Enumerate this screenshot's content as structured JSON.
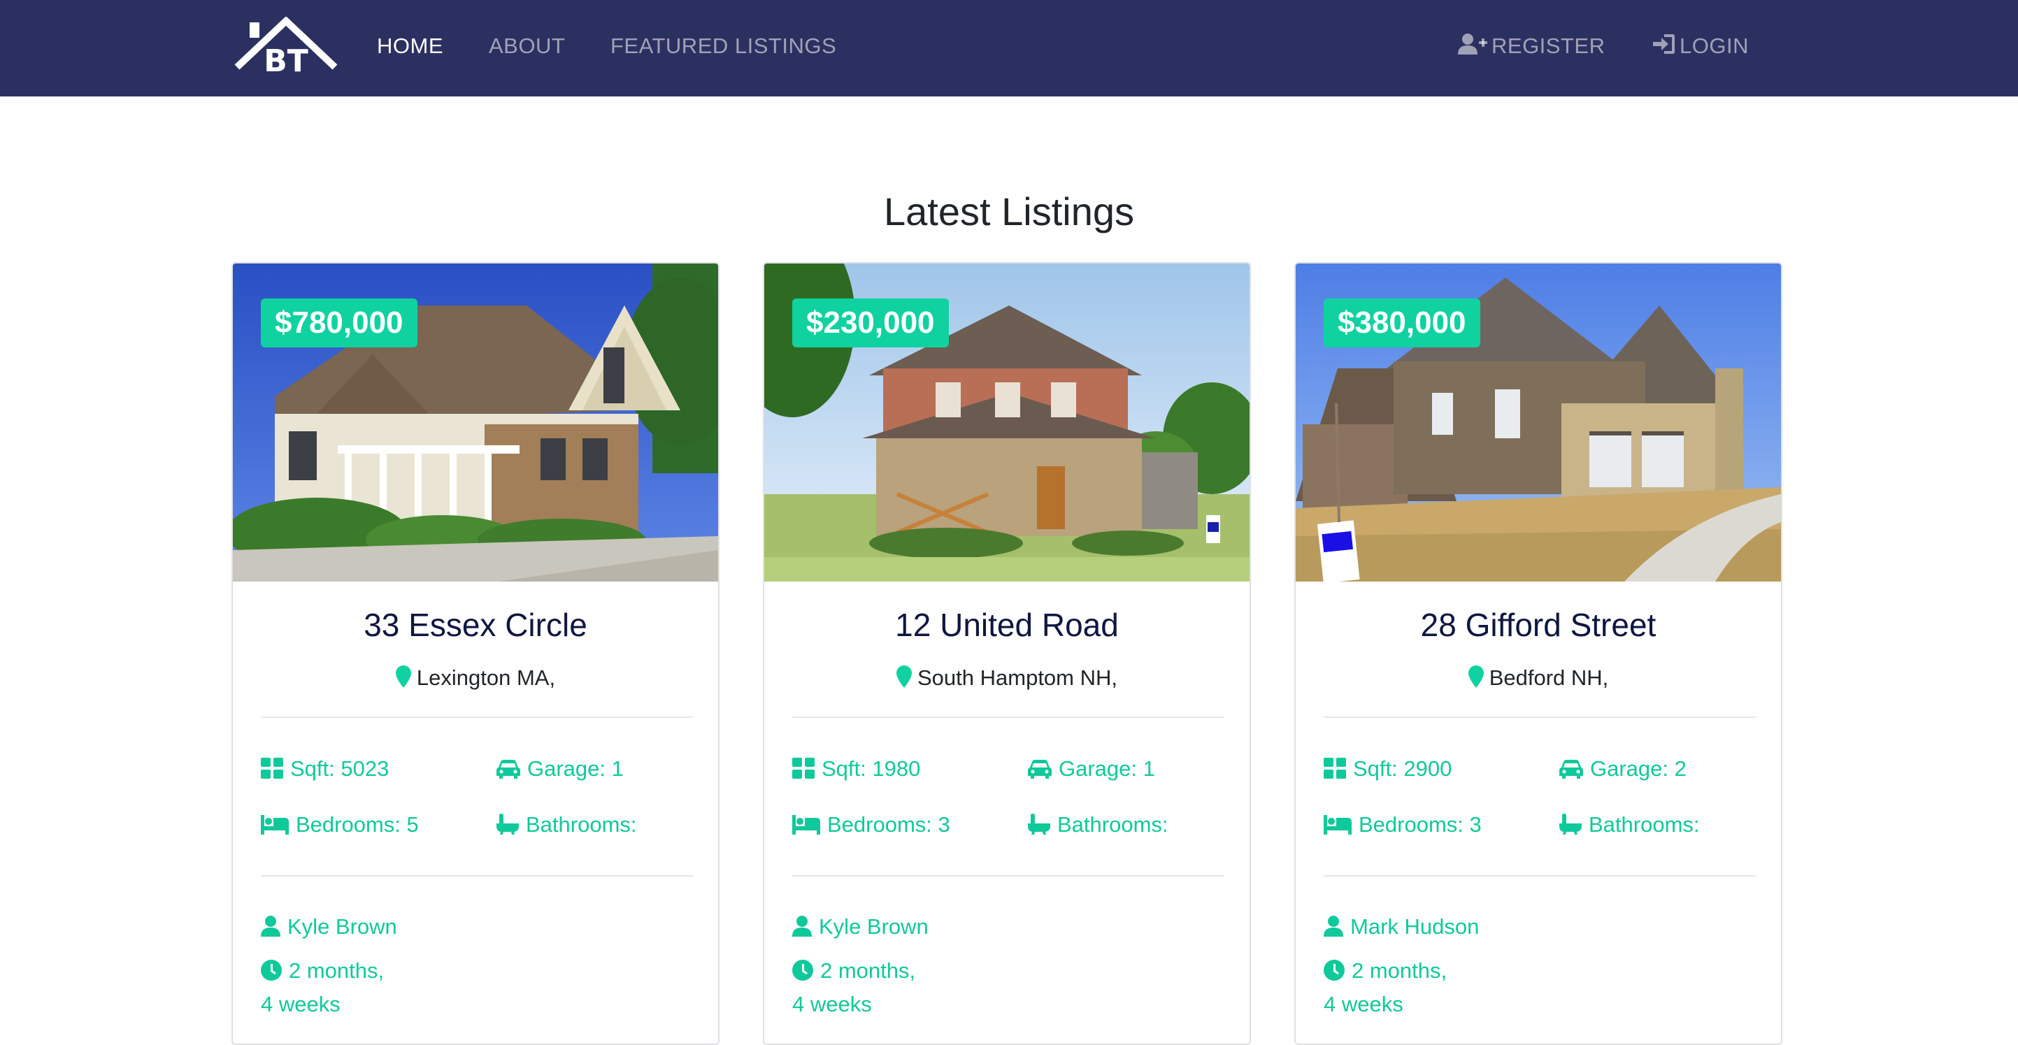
{
  "navbar": {
    "brand_text": "BT",
    "links": [
      {
        "label": "HOME",
        "active": true
      },
      {
        "label": "ABOUT",
        "active": false
      },
      {
        "label": "FEATURED LISTINGS",
        "active": false
      }
    ],
    "register_label": "REGISTER",
    "login_label": "LOGIN"
  },
  "section": {
    "title": "Latest Listings"
  },
  "colors": {
    "navbar": "#2c3061",
    "accent": "#10d2a0",
    "title": "#0f1640"
  },
  "listings": [
    {
      "price": "$780,000",
      "title": "33 Essex Circle",
      "location": "Lexington MA,",
      "sqft": "Sqft: 5023",
      "garage": "Garage: 1",
      "bedrooms": "Bedrooms: 5",
      "bathrooms": "Bathrooms:",
      "realtor": "Kyle Brown",
      "time_line1": "2 months,",
      "time_line2": "4 weeks"
    },
    {
      "price": "$230,000",
      "title": "12 United Road",
      "location": "South Hamptom NH,",
      "sqft": "Sqft: 1980",
      "garage": "Garage: 1",
      "bedrooms": "Bedrooms: 3",
      "bathrooms": "Bathrooms:",
      "realtor": "Kyle Brown",
      "time_line1": "2 months,",
      "time_line2": "4 weeks"
    },
    {
      "price": "$380,000",
      "title": "28 Gifford Street",
      "location": "Bedford NH,",
      "sqft": "Sqft: 2900",
      "garage": "Garage: 2",
      "bedrooms": "Bedrooms: 3",
      "bathrooms": "Bathrooms:",
      "realtor": "Mark Hudson",
      "time_line1": "2 months,",
      "time_line2": "4 weeks"
    }
  ],
  "icons": {
    "location": "map-marker-icon",
    "sqft": "th-large-icon",
    "garage": "car-icon",
    "bedrooms": "bed-icon",
    "bathrooms": "bath-icon",
    "realtor": "user-icon",
    "time": "clock-icon",
    "register": "user-plus-icon",
    "login": "sign-in-icon"
  }
}
